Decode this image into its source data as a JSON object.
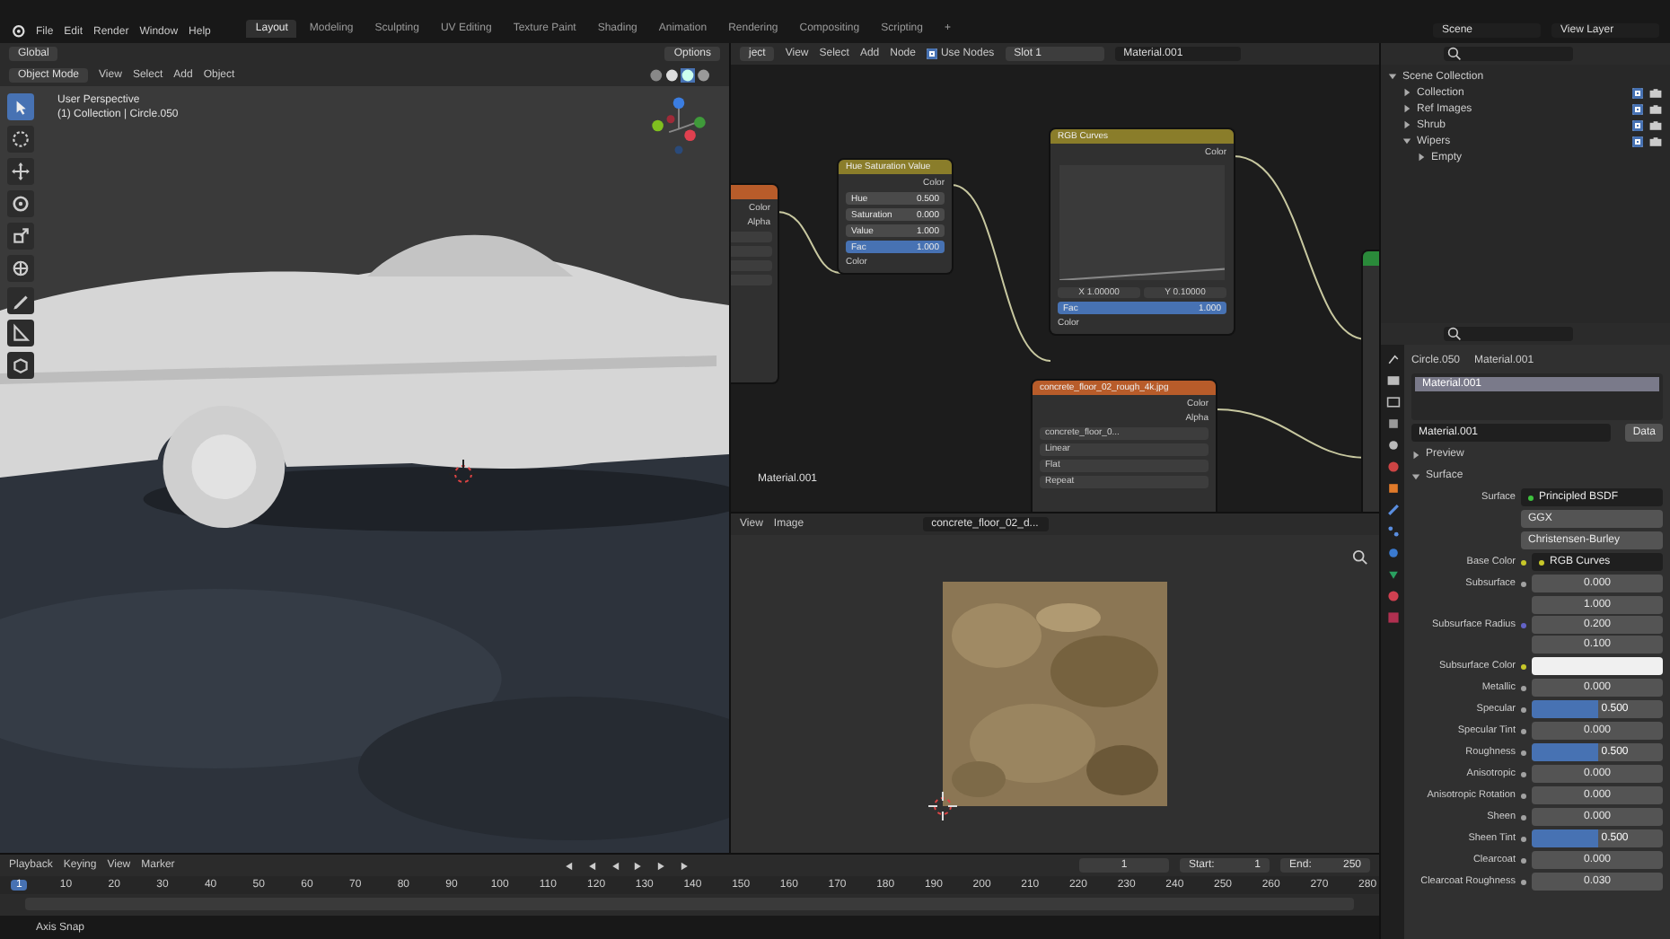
{
  "top_bar": {
    "menus": [
      "File",
      "Edit",
      "Render",
      "Window",
      "Help"
    ],
    "workspaces": [
      {
        "label": "Layout",
        "selected": true
      },
      {
        "label": "Modeling",
        "selected": false
      },
      {
        "label": "Sculpting",
        "selected": false
      },
      {
        "label": "UV Editing",
        "selected": false
      },
      {
        "label": "Texture Paint",
        "selected": false
      },
      {
        "label": "Shading",
        "selected": false
      },
      {
        "label": "Animation",
        "selected": false
      },
      {
        "label": "Rendering",
        "selected": false
      },
      {
        "label": "Compositing",
        "selected": false
      },
      {
        "label": "Scripting",
        "selected": false
      }
    ],
    "add_tab": "+",
    "scene": "Scene",
    "view_layer": "View Layer"
  },
  "viewport": {
    "transform": "Global",
    "options": "Options",
    "mode": "Object Mode",
    "menus": [
      "View",
      "Select",
      "Add",
      "Object"
    ],
    "info": [
      "User Perspective",
      "(1) Collection | Circle.050"
    ],
    "tools": [
      {
        "kind": "select",
        "selected": true
      },
      {
        "kind": "cursor",
        "selected": false
      },
      {
        "kind": "move",
        "selected": false
      },
      {
        "kind": "rotate",
        "selected": false
      },
      {
        "kind": "scale",
        "selected": false
      },
      {
        "kind": "transform",
        "selected": false
      },
      {
        "kind": "annotate",
        "selected": false
      },
      {
        "kind": "measure",
        "selected": false
      },
      {
        "kind": "add",
        "selected": false
      }
    ]
  },
  "node_editor": {
    "object_menu": "ject",
    "menus": [
      "View",
      "Select",
      "Add",
      "Node"
    ],
    "use_nodes": {
      "label": "Use Nodes",
      "checked": true
    },
    "slot": "Slot 1",
    "material": "Material.001",
    "material_label": "Material.001",
    "nodes": [
      {
        "kind": "image_cut",
        "outputs": [
          "Color",
          "Alpha"
        ]
      },
      {
        "kind": "hsv",
        "title": "Hue Saturation Value",
        "outputs": [
          "Color"
        ],
        "fields": [
          {
            "label": "Hue",
            "value": "0.500"
          },
          {
            "label": "Saturation",
            "value": "0.000"
          },
          {
            "label": "Value",
            "value": "1.000"
          },
          {
            "label": "Fac",
            "value": "1.000",
            "level": 1
          }
        ],
        "inputs": [
          "Color"
        ]
      },
      {
        "kind": "curves",
        "title": "RGB Curves",
        "outputs": [
          "Color"
        ],
        "coords": [
          "X 1.00000",
          "Y 0.10000"
        ],
        "fields": [
          {
            "label": "Fac",
            "value": "1.000",
            "level": 1
          }
        ],
        "inputs": [
          "Color"
        ]
      },
      {
        "title": "concrete_floor_02_rough_4k.jpg",
        "outputs": [
          "Color",
          "Alpha"
        ],
        "file": "concrete_floor_0...",
        "options": [
          "Linear",
          "Flat",
          "Repeat"
        ]
      },
      {
        "kind": "output_cut"
      }
    ]
  },
  "image_editor": {
    "menus": [
      "View",
      "Image"
    ],
    "image": "concrete_floor_02_d..."
  },
  "outliner": {
    "tree": [
      {
        "label": "Scene Collection",
        "expanded": true,
        "children": [
          {
            "label": "Collection",
            "expanded": false,
            "checked": true
          },
          {
            "label": "Ref Images",
            "expanded": false,
            "checked": true
          },
          {
            "label": "Shrub",
            "expanded": false,
            "checked": true
          },
          {
            "label": "Wipers",
            "expanded": true,
            "checked": true,
            "children": [
              {
                "label": "Empty",
                "expanded": false
              }
            ]
          }
        ]
      }
    ]
  },
  "properties": {
    "object": "Circle.050",
    "material": "Material.001",
    "slots": [
      {
        "name": "Material.001",
        "selected": true
      }
    ],
    "material_field": "Material.001",
    "link": "Data",
    "panels": [
      {
        "label": "Preview",
        "expanded": false
      },
      {
        "label": "Surface",
        "expanded": true
      }
    ],
    "surface_label": "Surface",
    "surface": "Principled BSDF",
    "dropdowns": [
      "GGX",
      "Christensen-Burley"
    ],
    "inputs": [
      {
        "kind": "link",
        "label": "Base Color",
        "value": "RGB Curves"
      },
      {
        "kind": "value",
        "label": "Subsurface",
        "value": "0.000"
      },
      {
        "kind": "vector",
        "label": "Subsurface Radius",
        "values": [
          "1.000",
          "0.200",
          "0.100"
        ]
      },
      {
        "kind": "color",
        "label": "Subsurface Color",
        "color": "#f0f0f0"
      },
      {
        "kind": "value",
        "label": "Metallic",
        "value": "0.000"
      },
      {
        "kind": "slider",
        "label": "Specular",
        "value": "0.500",
        "level": 0.5
      },
      {
        "kind": "value",
        "label": "Specular Tint",
        "value": "0.000"
      },
      {
        "kind": "slider",
        "label": "Roughness",
        "value": "0.500",
        "level": 0.5
      },
      {
        "kind": "value",
        "label": "Anisotropic",
        "value": "0.000"
      },
      {
        "kind": "value",
        "label": "Anisotropic Rotation",
        "value": "0.000"
      },
      {
        "kind": "value",
        "label": "Sheen",
        "value": "0.000"
      },
      {
        "kind": "slider",
        "label": "Sheen Tint",
        "value": "0.500",
        "level": 0.5
      },
      {
        "kind": "value",
        "label": "Clearcoat",
        "value": "0.000"
      },
      {
        "kind": "value",
        "label": "Clearcoat Roughness",
        "value": "0.030"
      }
    ]
  },
  "timeline": {
    "menus": [
      "Playback",
      "Keying",
      "View",
      "Marker"
    ],
    "frame": "1",
    "start_label": "Start:",
    "start": "1",
    "end_label": "End:",
    "end": "250",
    "current": "1",
    "ticks": [
      "10",
      "20",
      "30",
      "40",
      "50",
      "60",
      "70",
      "80",
      "90",
      "100",
      "110",
      "120",
      "130",
      "140",
      "150",
      "160",
      "170",
      "180",
      "190",
      "200",
      "210",
      "220",
      "230",
      "240",
      "250",
      "260",
      "270",
      "280"
    ]
  },
  "status_bar": {
    "hint": "Axis Snap"
  }
}
